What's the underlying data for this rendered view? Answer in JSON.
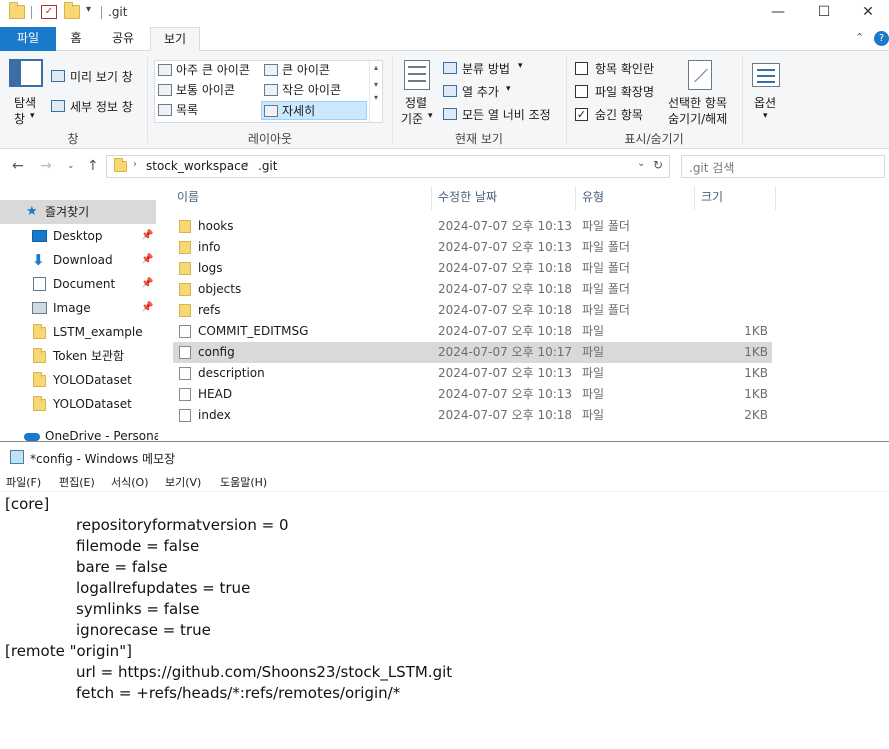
{
  "explorer": {
    "title": ".git",
    "window_controls": {
      "minimize": "—",
      "maximize": "☐",
      "close": "✕"
    },
    "tabs": [
      "파일",
      "홈",
      "공유",
      "보기"
    ],
    "ribbon": {
      "pane_group": {
        "nav_pane_label_line1": "탐색",
        "nav_pane_label_line2": "창",
        "preview_label": "미리 보기 창",
        "details_label": "세부 정보 창",
        "group_label": "창"
      },
      "layout_group": {
        "items": [
          "아주 큰 아이콘",
          "큰 아이콘",
          "보통 아이콘",
          "작은 아이콘",
          "목록",
          "자세히"
        ],
        "selected": "자세히",
        "group_label": "레이아웃"
      },
      "current_view_group": {
        "sort_line1": "정렬",
        "sort_line2": "기준",
        "group_by": "분류 방법",
        "add_columns": "열 추가",
        "fit_columns": "모든 열 너비 조정",
        "group_label": "현재 보기"
      },
      "show_hide_group": {
        "item_checkboxes": "항목 확인란",
        "file_extensions": "파일 확장명",
        "hidden_items": "숨긴 항목",
        "item_checkboxes_checked": false,
        "file_extensions_checked": false,
        "hidden_items_checked": true,
        "hide_selected_line1": "선택한 항목",
        "hide_selected_line2": "숨기기/해제",
        "group_label": "표시/숨기기"
      },
      "options_label": "옵션"
    },
    "address": {
      "breadcrumb": [
        "stock_workspace",
        ".git"
      ],
      "search_placeholder": ".git 검색"
    },
    "nav_pane": {
      "quick_access": "즐겨찾기",
      "items": [
        {
          "label": "Desktop",
          "pinned": true
        },
        {
          "label": "Download",
          "pinned": true
        },
        {
          "label": "Document",
          "pinned": true
        },
        {
          "label": "Image",
          "pinned": true
        },
        {
          "label": "LSTM_example",
          "pinned": false
        },
        {
          "label": "Token 보관함",
          "pinned": false
        },
        {
          "label": "YOLODataset",
          "pinned": false
        },
        {
          "label": "YOLODataset",
          "pinned": false
        }
      ],
      "onedrive": "OneDrive - Personal"
    },
    "columns": {
      "name": "이름",
      "modified": "수정한 날짜",
      "type": "유형",
      "size": "크기"
    },
    "files": [
      {
        "name": "hooks",
        "modified": "2024-07-07 오후 10:13",
        "type": "파일 폴더",
        "size": "",
        "folder": true
      },
      {
        "name": "info",
        "modified": "2024-07-07 오후 10:13",
        "type": "파일 폴더",
        "size": "",
        "folder": true
      },
      {
        "name": "logs",
        "modified": "2024-07-07 오후 10:18",
        "type": "파일 폴더",
        "size": "",
        "folder": true
      },
      {
        "name": "objects",
        "modified": "2024-07-07 오후 10:18",
        "type": "파일 폴더",
        "size": "",
        "folder": true
      },
      {
        "name": "refs",
        "modified": "2024-07-07 오후 10:18",
        "type": "파일 폴더",
        "size": "",
        "folder": true
      },
      {
        "name": "COMMIT_EDITMSG",
        "modified": "2024-07-07 오후 10:18",
        "type": "파일",
        "size": "1KB",
        "folder": false
      },
      {
        "name": "config",
        "modified": "2024-07-07 오후 10:17",
        "type": "파일",
        "size": "1KB",
        "folder": false,
        "selected": true
      },
      {
        "name": "description",
        "modified": "2024-07-07 오후 10:13",
        "type": "파일",
        "size": "1KB",
        "folder": false
      },
      {
        "name": "HEAD",
        "modified": "2024-07-07 오후 10:13",
        "type": "파일",
        "size": "1KB",
        "folder": false
      },
      {
        "name": "index",
        "modified": "2024-07-07 오후 10:18",
        "type": "파일",
        "size": "2KB",
        "folder": false
      }
    ]
  },
  "notepad": {
    "title": "*config - Windows 메모장",
    "menu": [
      "파일(F)",
      "편집(E)",
      "서식(O)",
      "보기(V)",
      "도움말(H)"
    ],
    "lines": [
      {
        "text": "[core]",
        "indent": false
      },
      {
        "text": "repositoryformatversion = 0",
        "indent": true
      },
      {
        "text": "filemode = false",
        "indent": true
      },
      {
        "text": "bare = false",
        "indent": true
      },
      {
        "text": "logallrefupdates = true",
        "indent": true
      },
      {
        "text": "symlinks = false",
        "indent": true
      },
      {
        "text": "ignorecase = true",
        "indent": true
      },
      {
        "text": "[remote \"origin\"]",
        "indent": false
      },
      {
        "text": "url = https://github.com/Shoons23/stock_LSTM.git",
        "indent": true
      },
      {
        "text": "fetch = +refs/heads/*:refs/remotes/origin/*",
        "indent": true
      }
    ]
  }
}
